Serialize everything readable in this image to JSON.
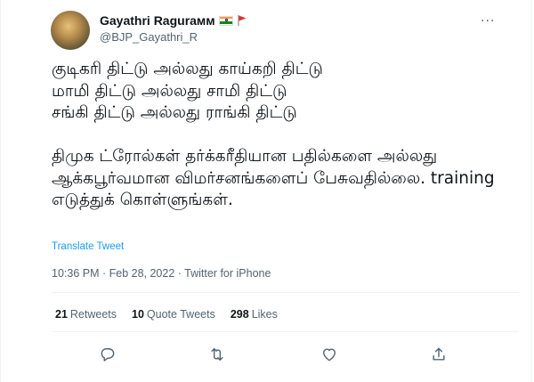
{
  "header": {
    "display_name": "Gayathri Ragurамм",
    "handle": "@BJP_Gayathri_R",
    "more_label": "···"
  },
  "tweet": {
    "text": "குடிகரி திட்டு அல்லது காய்கறி திட்டு\nமாமி திட்டு அல்லது சாமி திட்டு\nசங்கி திட்டு அல்லது ராங்கி திட்டு\n\nதிமுக ட்ரோல்கள் தர்க்கரீதியான பதில்களை அல்லது ஆக்கபூர்வமான விமர்சனங்களைப் பேசுவதில்லை. training எடுத்துக் கொள்ளுங்கள்.",
    "translate_label": "Translate Tweet",
    "meta": "10:36 PM · Feb 28, 2022 · Twitter for iPhone"
  },
  "stats": {
    "retweets_count": "21",
    "retweets_label": "Retweets",
    "quotes_count": "10",
    "quotes_label": "Quote Tweets",
    "likes_count": "298",
    "likes_label": "Likes"
  },
  "actions": [
    "reply-icon",
    "retweet-icon",
    "like-icon",
    "share-icon"
  ],
  "colors": {
    "accent": "#1d9bf0",
    "muted": "#536471",
    "text": "#0f1419"
  }
}
